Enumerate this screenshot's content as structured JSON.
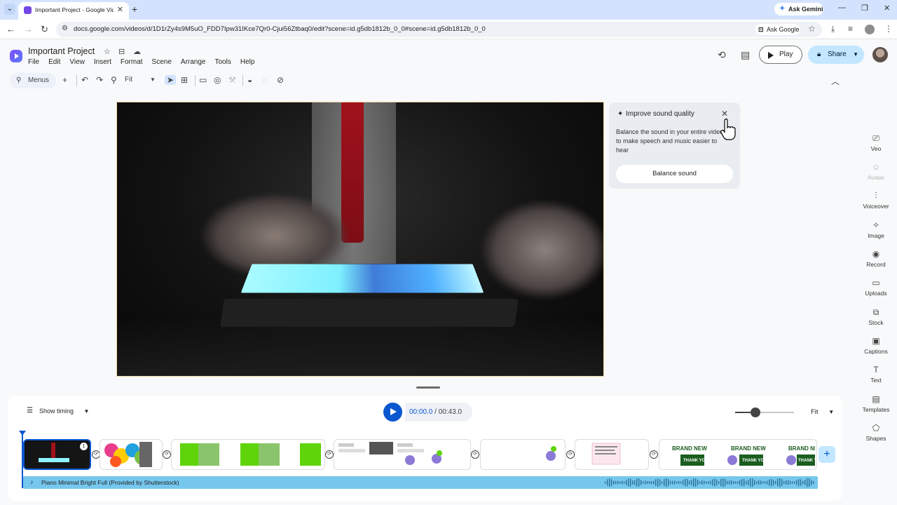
{
  "browser": {
    "tab_title": "Important Project - Google Vid",
    "url": "docs.google.com/videos/d/1D1rZy4s9M5uO_FDD7Ipw31IKce7Qr0-Cjui56Ztbaq0/edit?scene=id.g5db1812b_0_0#scene=id.g5db1812b_0_0",
    "ask_gemini": "Ask Gemini",
    "ask_google": "Ask Google"
  },
  "doc": {
    "title": "Important Project",
    "menus": [
      "File",
      "Edit",
      "View",
      "Insert",
      "Format",
      "Scene",
      "Arrange",
      "Tools",
      "Help"
    ]
  },
  "header": {
    "play_label": "Play",
    "share_label": "Share"
  },
  "toolbar": {
    "menus_label": "Menus",
    "zoom_value": "Fit"
  },
  "sound_card": {
    "title": "Improve sound quality",
    "body": "Balance the sound in your entire video to make speech and music easier to hear",
    "button_label": "Balance sound"
  },
  "side_panel": [
    {
      "label": "Veo",
      "icon": "film-icon",
      "disabled": false
    },
    {
      "label": "Avatar",
      "icon": "avatar-icon",
      "disabled": true
    },
    {
      "label": "Voiceover",
      "icon": "voiceover-icon",
      "disabled": false
    },
    {
      "label": "Image",
      "icon": "image-spark-icon",
      "disabled": false
    },
    {
      "label": "Record",
      "icon": "record-icon",
      "disabled": false
    },
    {
      "label": "Uploads",
      "icon": "folder-icon",
      "disabled": false
    },
    {
      "label": "Stock",
      "icon": "stock-icon",
      "disabled": false
    },
    {
      "label": "Captions",
      "icon": "captions-icon",
      "disabled": false
    },
    {
      "label": "Text",
      "icon": "text-icon",
      "disabled": false
    },
    {
      "label": "Templates",
      "icon": "templates-icon",
      "disabled": false
    },
    {
      "label": "Shapes",
      "icon": "shapes-icon",
      "disabled": false
    }
  ],
  "timeline": {
    "show_timing_label": "Show timing",
    "current_time": "00:00.0",
    "separator": " / ",
    "total_time": "00:43.0",
    "zoom_label": "Fit",
    "zoom_level": 0.35,
    "selected_scene_number": "1",
    "audio_track_label": "Piano Minimal Bright Full (Provided by Shutterstock)",
    "thumb_texts": {
      "brand_new": "BRAND NEW",
      "thank_you": "THANK YOU"
    }
  },
  "colors": {
    "accent": "#0b57d0",
    "share_bg": "#c2e7ff",
    "audio_track": "#76c7ee",
    "tie": "#a0121c"
  }
}
